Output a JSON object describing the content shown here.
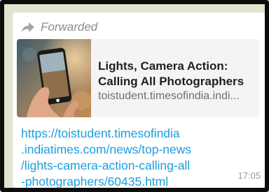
{
  "message": {
    "forwarded_label": "Forwarded",
    "link_preview": {
      "title": "Lights, Camera Action:\nCalling All Photographers",
      "domain": "toistudent.timesofindia.indi..."
    },
    "link_text": "https://toistudent.timesofindia\n.indiatimes.com/news/top-news\n/lights-camera-action-calling-all\n-photographers/60435.html",
    "timestamp": "17:05"
  },
  "colors": {
    "link": "#1a9fdf",
    "forwarded_gray": "#8c8c8c",
    "bubble_bg": "#ffffff",
    "preview_bg": "#f4f4f4"
  },
  "icons": {
    "forward": "forward-arrow-icon"
  }
}
